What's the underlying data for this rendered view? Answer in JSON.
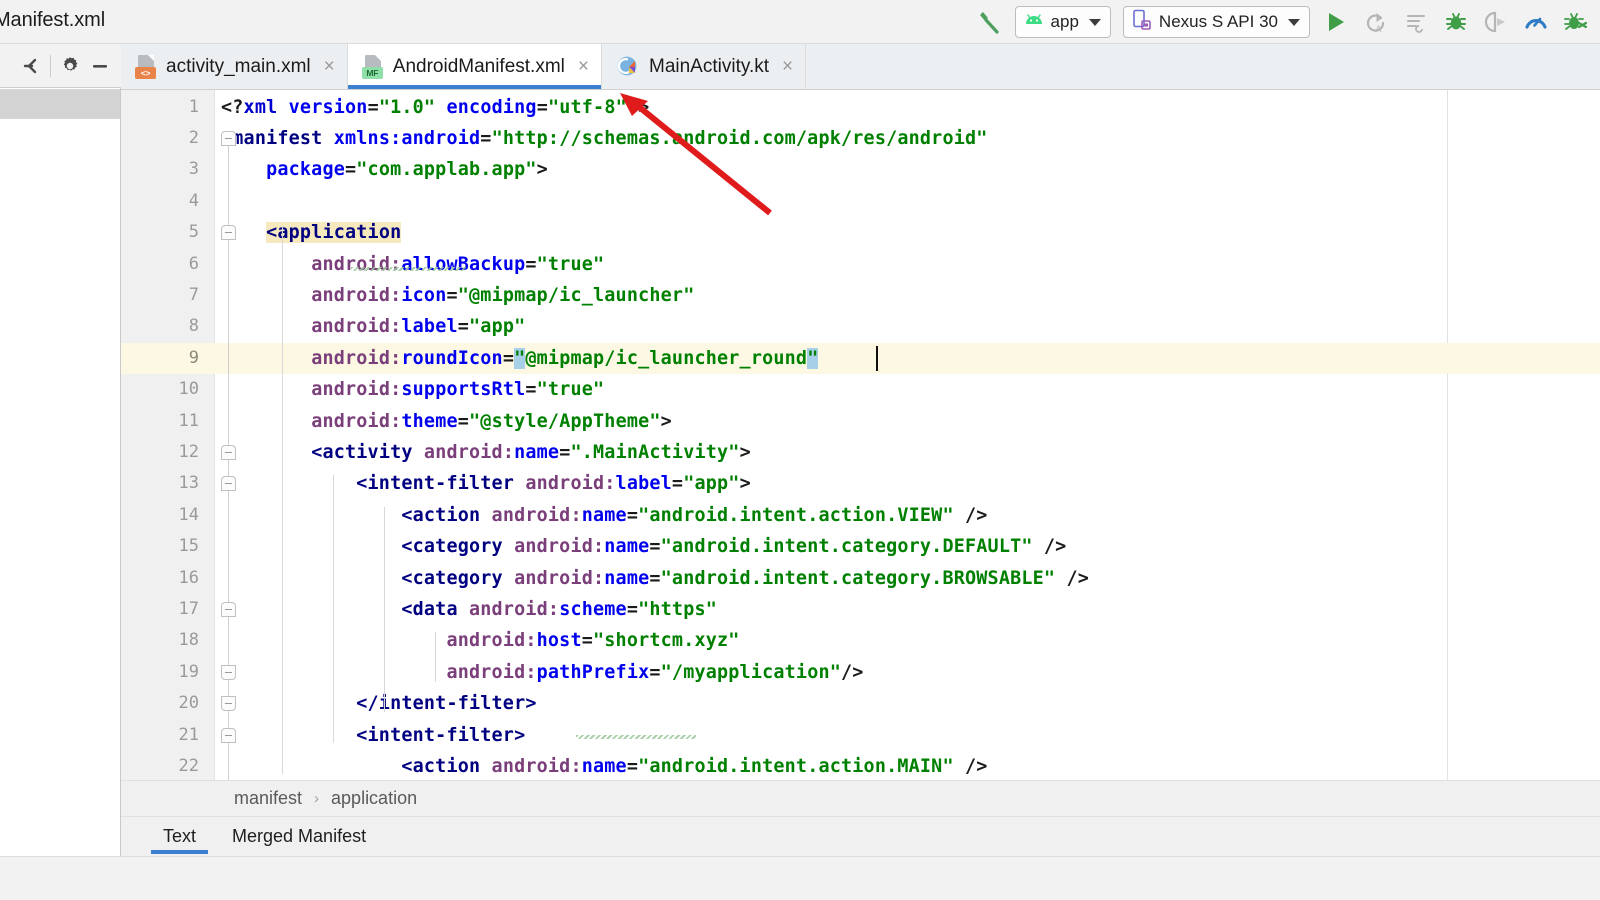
{
  "window": {
    "title": "Manifest.xml"
  },
  "toolbar": {
    "build_icon": "hammer-icon",
    "module_selector": {
      "label": "app",
      "icon": "android-robot-icon"
    },
    "device_selector": {
      "label": "Nexus S API 30",
      "icon": "phone-icon"
    },
    "actions": [
      {
        "name": "run-button",
        "icon": "play-triangle-icon"
      },
      {
        "name": "apply-changes-button",
        "icon": "apply-changes-icon"
      },
      {
        "name": "apply-code-changes-button",
        "icon": "apply-code-changes-icon"
      },
      {
        "name": "debug-button",
        "icon": "bug-icon"
      },
      {
        "name": "attach-debugger-button",
        "icon": "attach-debugger-icon"
      },
      {
        "name": "profiler-button",
        "icon": "profiler-gauge-icon"
      },
      {
        "name": "debug-over-network-button",
        "icon": "bug-network-icon"
      }
    ]
  },
  "left_panel": {
    "header_icons": [
      {
        "name": "collapse-all-icon"
      },
      {
        "name": "gear-icon"
      },
      {
        "name": "minimize-icon"
      }
    ]
  },
  "tabs": [
    {
      "label": "activity_main.xml",
      "badge": "<>",
      "badge_kind": "xml",
      "active": false,
      "close": "×"
    },
    {
      "label": "AndroidManifest.xml",
      "badge": "MF",
      "badge_kind": "mf",
      "active": true,
      "close": "×"
    },
    {
      "label": "MainActivity.kt",
      "badge": "K",
      "badge_kind": "kotlin",
      "active": false,
      "close": "×"
    }
  ],
  "editor": {
    "highlight_line": 9,
    "lines": [
      {
        "n": 1,
        "tokens": [
          {
            "t": "<?",
            "c": "punc"
          },
          {
            "t": "xml",
            "c": "proc"
          },
          {
            "t": " ",
            "c": "punc"
          },
          {
            "t": "version",
            "c": "attr2"
          },
          {
            "t": "=",
            "c": "punc"
          },
          {
            "t": "\"1.0\"",
            "c": "str"
          },
          {
            "t": " ",
            "c": "punc"
          },
          {
            "t": "encoding",
            "c": "attr2"
          },
          {
            "t": "=",
            "c": "punc"
          },
          {
            "t": "\"utf-8\"",
            "c": "str"
          },
          {
            "t": "?>",
            "c": "punc"
          }
        ]
      },
      {
        "n": 2,
        "tokens": [
          {
            "t": "<manifest ",
            "c": "tag"
          },
          {
            "t": "xmlns:android",
            "c": "attr2"
          },
          {
            "t": "=",
            "c": "punc"
          },
          {
            "t": "\"http://schemas.android.com/apk/res/android\"",
            "c": "str"
          }
        ]
      },
      {
        "n": 3,
        "tokens": [
          {
            "t": "    ",
            "c": "punc"
          },
          {
            "t": "package",
            "c": "attr2"
          },
          {
            "t": "=",
            "c": "punc"
          },
          {
            "t": "\"com.applab.app\"",
            "c": "str"
          },
          {
            "t": ">",
            "c": "punc"
          }
        ]
      },
      {
        "n": 4,
        "tokens": []
      },
      {
        "n": 5,
        "tokens": [
          {
            "t": "    ",
            "c": "punc"
          },
          {
            "t": "<application",
            "c": "tag-hl"
          }
        ]
      },
      {
        "n": 6,
        "tokens": [
          {
            "t": "        ",
            "c": "punc"
          },
          {
            "t": "android:",
            "c": "attr"
          },
          {
            "t": "allowBackup",
            "c": "attr2"
          },
          {
            "t": "=",
            "c": "punc"
          },
          {
            "t": "\"true\"",
            "c": "str"
          }
        ]
      },
      {
        "n": 7,
        "tokens": [
          {
            "t": "        ",
            "c": "punc"
          },
          {
            "t": "android:",
            "c": "attr"
          },
          {
            "t": "icon",
            "c": "attr2"
          },
          {
            "t": "=",
            "c": "punc"
          },
          {
            "t": "\"@mipmap/ic_launcher\"",
            "c": "str"
          }
        ]
      },
      {
        "n": 8,
        "tokens": [
          {
            "t": "        ",
            "c": "punc"
          },
          {
            "t": "android:",
            "c": "attr"
          },
          {
            "t": "label",
            "c": "attr2"
          },
          {
            "t": "=",
            "c": "punc"
          },
          {
            "t": "\"app\"",
            "c": "str"
          }
        ]
      },
      {
        "n": 9,
        "tokens": [
          {
            "t": "        ",
            "c": "punc"
          },
          {
            "t": "android:",
            "c": "attr"
          },
          {
            "t": "roundIcon",
            "c": "attr2"
          },
          {
            "t": "=",
            "c": "punc"
          },
          {
            "t": "\"",
            "c": "str-sel"
          },
          {
            "t": "@mipmap/ic_launcher_round",
            "c": "str"
          },
          {
            "t": "\"",
            "c": "str-sel"
          }
        ]
      },
      {
        "n": 10,
        "tokens": [
          {
            "t": "        ",
            "c": "punc"
          },
          {
            "t": "android:",
            "c": "attr"
          },
          {
            "t": "supportsRtl",
            "c": "attr2"
          },
          {
            "t": "=",
            "c": "punc"
          },
          {
            "t": "\"true\"",
            "c": "str"
          }
        ]
      },
      {
        "n": 11,
        "tokens": [
          {
            "t": "        ",
            "c": "punc"
          },
          {
            "t": "android:",
            "c": "attr"
          },
          {
            "t": "theme",
            "c": "attr2"
          },
          {
            "t": "=",
            "c": "punc"
          },
          {
            "t": "\"@style/AppTheme\"",
            "c": "str"
          },
          {
            "t": ">",
            "c": "punc"
          }
        ]
      },
      {
        "n": 12,
        "tokens": [
          {
            "t": "        ",
            "c": "punc"
          },
          {
            "t": "<activity ",
            "c": "tag"
          },
          {
            "t": "android:",
            "c": "attr"
          },
          {
            "t": "name",
            "c": "attr2"
          },
          {
            "t": "=",
            "c": "punc"
          },
          {
            "t": "\".MainActivity\"",
            "c": "str"
          },
          {
            "t": ">",
            "c": "punc"
          }
        ]
      },
      {
        "n": 13,
        "tokens": [
          {
            "t": "            ",
            "c": "punc"
          },
          {
            "t": "<intent-filter ",
            "c": "tag"
          },
          {
            "t": "android:",
            "c": "attr"
          },
          {
            "t": "label",
            "c": "attr2"
          },
          {
            "t": "=",
            "c": "punc"
          },
          {
            "t": "\"app\"",
            "c": "str"
          },
          {
            "t": ">",
            "c": "punc"
          }
        ]
      },
      {
        "n": 14,
        "tokens": [
          {
            "t": "                ",
            "c": "punc"
          },
          {
            "t": "<action ",
            "c": "tag"
          },
          {
            "t": "android:",
            "c": "attr"
          },
          {
            "t": "name",
            "c": "attr2"
          },
          {
            "t": "=",
            "c": "punc"
          },
          {
            "t": "\"android.intent.action.VIEW\"",
            "c": "str"
          },
          {
            "t": " />",
            "c": "punc"
          }
        ]
      },
      {
        "n": 15,
        "tokens": [
          {
            "t": "                ",
            "c": "punc"
          },
          {
            "t": "<category ",
            "c": "tag"
          },
          {
            "t": "android:",
            "c": "attr"
          },
          {
            "t": "name",
            "c": "attr2"
          },
          {
            "t": "=",
            "c": "punc"
          },
          {
            "t": "\"android.intent.category.DEFAULT\"",
            "c": "str"
          },
          {
            "t": " />",
            "c": "punc"
          }
        ]
      },
      {
        "n": 16,
        "tokens": [
          {
            "t": "                ",
            "c": "punc"
          },
          {
            "t": "<category ",
            "c": "tag"
          },
          {
            "t": "android:",
            "c": "attr"
          },
          {
            "t": "name",
            "c": "attr2"
          },
          {
            "t": "=",
            "c": "punc"
          },
          {
            "t": "\"android.intent.category.BROWSABLE\"",
            "c": "str"
          },
          {
            "t": " />",
            "c": "punc"
          }
        ]
      },
      {
        "n": 17,
        "tokens": [
          {
            "t": "                ",
            "c": "punc"
          },
          {
            "t": "<data ",
            "c": "tag"
          },
          {
            "t": "android:",
            "c": "attr"
          },
          {
            "t": "scheme",
            "c": "attr2"
          },
          {
            "t": "=",
            "c": "punc"
          },
          {
            "t": "\"https\"",
            "c": "str"
          }
        ]
      },
      {
        "n": 18,
        "tokens": [
          {
            "t": "                    ",
            "c": "punc"
          },
          {
            "t": "android:",
            "c": "attr"
          },
          {
            "t": "host",
            "c": "attr2"
          },
          {
            "t": "=",
            "c": "punc"
          },
          {
            "t": "\"shortcm.xyz\"",
            "c": "str"
          }
        ]
      },
      {
        "n": 19,
        "tokens": [
          {
            "t": "                    ",
            "c": "punc"
          },
          {
            "t": "android:",
            "c": "attr"
          },
          {
            "t": "pathPrefix",
            "c": "attr2"
          },
          {
            "t": "=",
            "c": "punc"
          },
          {
            "t": "\"/myapplication\"",
            "c": "str"
          },
          {
            "t": "/>",
            "c": "punc"
          }
        ]
      },
      {
        "n": 20,
        "tokens": [
          {
            "t": "            ",
            "c": "punc"
          },
          {
            "t": "</intent-filter>",
            "c": "tag"
          }
        ]
      },
      {
        "n": 21,
        "tokens": [
          {
            "t": "            ",
            "c": "punc"
          },
          {
            "t": "<intent-filter>",
            "c": "tag"
          }
        ]
      },
      {
        "n": 22,
        "tokens": [
          {
            "t": "                ",
            "c": "punc"
          },
          {
            "t": "<action ",
            "c": "tag"
          },
          {
            "t": "android:",
            "c": "attr"
          },
          {
            "t": "name",
            "c": "attr2"
          },
          {
            "t": "=",
            "c": "punc"
          },
          {
            "t": "\"android.intent.action.MAIN\"",
            "c": "str"
          },
          {
            "t": " />",
            "c": "punc"
          }
        ]
      }
    ],
    "fold_markers": [
      {
        "line": 2,
        "dir": "dn"
      },
      {
        "line": 5,
        "dir": "dn"
      },
      {
        "line": 12,
        "dir": "dn"
      },
      {
        "line": 13,
        "dir": "dn"
      },
      {
        "line": 17,
        "dir": "dn"
      },
      {
        "line": 19,
        "dir": "up"
      },
      {
        "line": 20,
        "dir": "up"
      },
      {
        "line": 21,
        "dir": "dn"
      }
    ]
  },
  "breadcrumb": {
    "items": [
      "manifest",
      "application"
    ],
    "separator": "›"
  },
  "bottom_tabs": [
    {
      "label": "Text",
      "selected": true
    },
    {
      "label": "Merged Manifest",
      "selected": false
    }
  ],
  "annotation": {
    "name": "red-arrow",
    "color": "#e01b1b"
  },
  "colors": {
    "accent_blue": "#3c7fd1",
    "string_green": "#008000",
    "tag_navy": "#000080",
    "attr_purple": "#7a3e7a",
    "attr_blue": "#0000ee",
    "highlight_line": "#fcf8e4",
    "selection_blue": "#a8cfe8",
    "android_green": "#3ddc84"
  }
}
